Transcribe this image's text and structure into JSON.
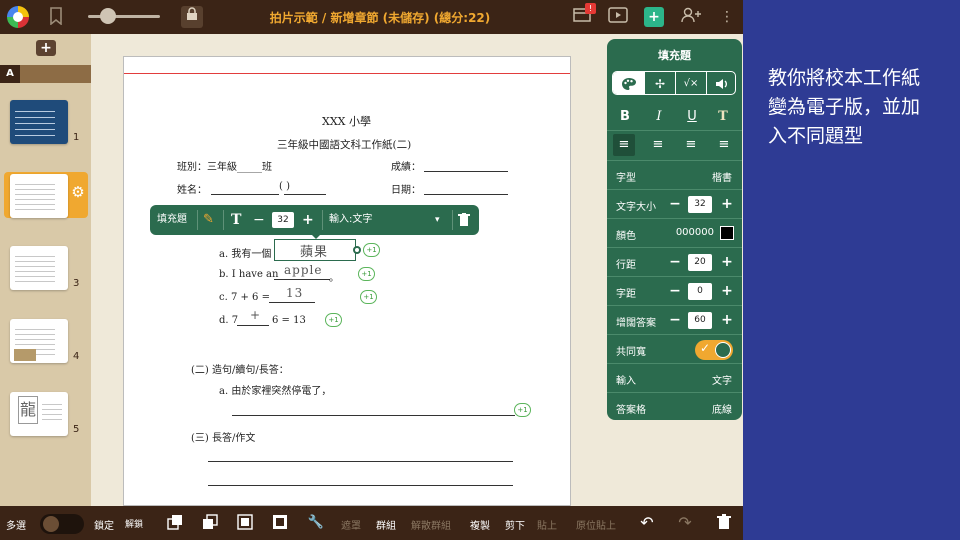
{
  "topbar": {
    "title": "拍片示範 / 新增章節 (未儲存) (總分:22)",
    "badge": "!",
    "icons": [
      "app-logo-icon",
      "bookmark-icon",
      "zoom-slider",
      "lock-icon",
      "present-screen-icon",
      "play-icon",
      "add-page-icon",
      "add-user-icon",
      "more-vert-icon"
    ]
  },
  "sidebar": {
    "add_label": "+",
    "section_label": "A",
    "slides": [
      {
        "num": "1"
      },
      {
        "num": "2"
      },
      {
        "num": "3"
      },
      {
        "num": "4"
      },
      {
        "num": "5"
      }
    ]
  },
  "worksheet": {
    "school": "XXX 小學",
    "heading": "三年級中國語文科工作紙(二)",
    "class_label": "班別：三年級_____班",
    "grade_label": "成績：",
    "name_label": "姓名：",
    "name_paren": "(          )",
    "date_label": "日期：",
    "q_a": "a.  我有一個",
    "q_a_answer": "蘋果",
    "q_b": "b.  I have an",
    "q_b_answer": "apple",
    "q_b_end": "。",
    "q_c": "c.  7 + 6 =",
    "q_c_answer": "13",
    "q_d_left": "d.  7",
    "q_d_answer": "+",
    "q_d_right": "6 = 13",
    "section2": "(二)  造句/續句/長答：",
    "s2_a": "a.  由於家裡突然停電了，",
    "section3": "(三)  長答/作文",
    "plus_label": "+1"
  },
  "floatbar": {
    "type_label": "填充題",
    "text_icon": "T",
    "minus": "−",
    "font_size": "32",
    "plus": "+",
    "input_label": "輸入:文字",
    "dropdown_icon": "▾",
    "delete_icon": "🗑"
  },
  "props": {
    "title": "填充題",
    "tabs": [
      "🎨",
      "✢",
      "√×",
      "🔊"
    ],
    "format": {
      "bold": "B",
      "italic": "I",
      "underline": "U",
      "type": "T"
    },
    "align": [
      "≡",
      "≡",
      "≡",
      "≡"
    ],
    "font_label": "字型",
    "font_value": "楷書",
    "size_label": "文字大小",
    "size_value": "32",
    "color_label": "顏色",
    "color_value": "000000",
    "line_label": "行距",
    "line_value": "20",
    "char_label": "字距",
    "char_value": "0",
    "answer_label": "增闊答案",
    "answer_value": "60",
    "same_width_label": "共同寬",
    "same_width_on": true,
    "input_label": "輸入",
    "input_value": "文字",
    "box_label": "答案格",
    "box_value": "底線",
    "minus": "−",
    "plus": "+"
  },
  "bottombar": {
    "multi": "多選",
    "lock": "鎖定",
    "unlock": "解鎖",
    "mask": "遮罩",
    "group": "群組",
    "ungroup": "解散群組",
    "copy": "複製",
    "cut": "剪下",
    "paste": "貼上",
    "paste_in_place": "原位貼上"
  },
  "caption": {
    "text": "教你將校本工作紙變為電子版，並加入不同題型"
  },
  "colors": {
    "chrome": "#3b2416",
    "accent": "#f0a830",
    "panel_green": "#2b6b4e",
    "background": "#2e3b94"
  }
}
